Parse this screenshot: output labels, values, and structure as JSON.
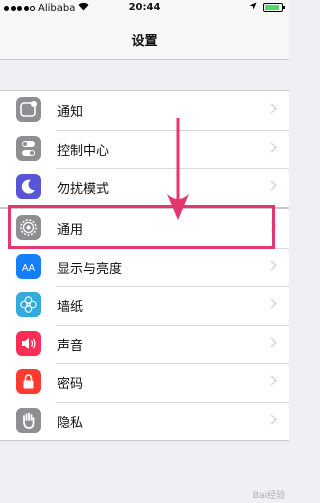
{
  "status_bar": {
    "carrier": "Alibaba",
    "time": "20:44",
    "signal_bars": 4,
    "battery_level": 0.85,
    "battery_color": "#4cd964"
  },
  "nav": {
    "title": "设置"
  },
  "groups": [
    {
      "items": [
        {
          "label": "通知",
          "icon": "notifications-icon",
          "color": "#8e8e93"
        },
        {
          "label": "控制中心",
          "icon": "control-center-icon",
          "color": "#8e8e93"
        },
        {
          "label": "勿扰模式",
          "icon": "moon-icon",
          "color": "#5856d6"
        }
      ]
    },
    {
      "items": [
        {
          "label": "通用",
          "icon": "gear-icon",
          "color": "#8e8e93"
        },
        {
          "label": "显示与亮度",
          "icon": "display-brightness-icon",
          "color": "#147efb"
        },
        {
          "label": "墙纸",
          "icon": "wallpaper-icon",
          "color": "#34aadc"
        },
        {
          "label": "声音",
          "icon": "speaker-icon",
          "color": "#ff2d55"
        },
        {
          "label": "密码",
          "icon": "lock-icon",
          "color": "#ff3b30"
        },
        {
          "label": "隐私",
          "icon": "hand-icon",
          "color": "#8e8e93"
        }
      ]
    }
  ],
  "annotation": {
    "color": "#e6366f",
    "highlighted_item": "通用"
  },
  "watermark": "Bai经验"
}
